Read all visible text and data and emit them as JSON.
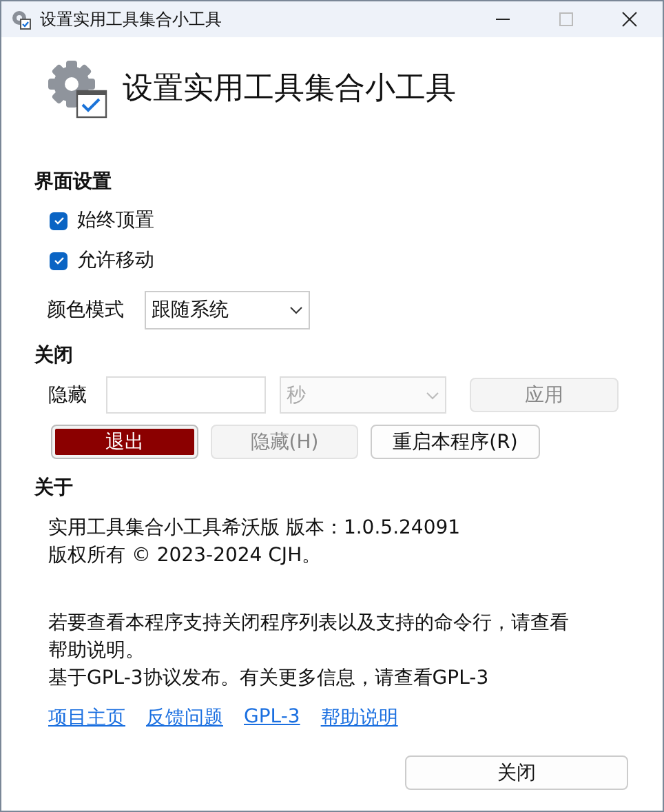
{
  "window": {
    "title": "设置实用工具集合小工具"
  },
  "header": {
    "title": "设置实用工具集合小工具"
  },
  "ui_section": {
    "title": "界面设置",
    "checkboxes": [
      {
        "label": "始终顶置",
        "checked": true
      },
      {
        "label": "允许移动",
        "checked": true
      }
    ],
    "color_mode": {
      "label": "颜色模式",
      "value": "跟随系统"
    }
  },
  "close_section": {
    "title": "关闭",
    "hide_label": "隐藏",
    "unit": {
      "value": "秒",
      "disabled": true
    },
    "apply": {
      "label": "应用",
      "disabled": true
    },
    "buttons": [
      {
        "label": "退出",
        "kind": "danger",
        "disabled": false
      },
      {
        "label": "隐藏(H)",
        "kind": "normal",
        "disabled": true
      },
      {
        "label": "重启本程序(R)",
        "kind": "normal",
        "disabled": false
      }
    ]
  },
  "about_section": {
    "title": "关于",
    "lines": [
      "实用工具集合小工具希沃版 版本：1.0.5.24091",
      "版权所有 © 2023-2024 CJH。"
    ],
    "notes": [
      "若要查看本程序支持关闭程序列表以及支持的命令行，请查看帮助说明。",
      "基于GPL-3协议发布。有关更多信息，请查看GPL-3"
    ],
    "links": [
      "项目主页",
      "反馈问题",
      "GPL-3",
      "帮助说明"
    ]
  },
  "footer": {
    "close": "关闭"
  }
}
